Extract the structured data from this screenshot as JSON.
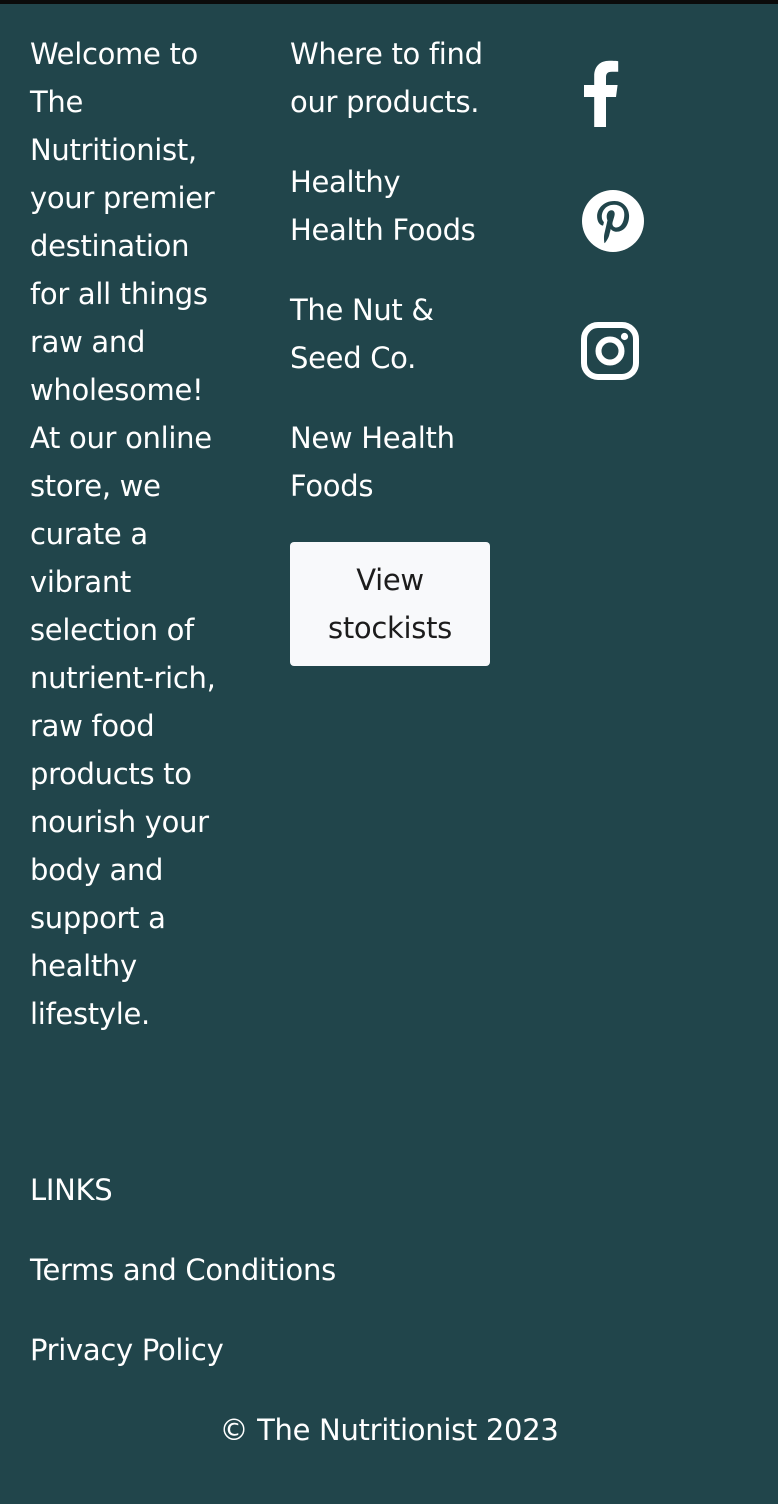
{
  "about": {
    "text": "Welcome to The Nutritionist, your premier destination for all things raw and wholesome! At our online store, we curate a vibrant selection of nutrient-rich, raw food products to nourish your body and support a healthy lifestyle."
  },
  "stockists": {
    "heading": "Where to find our products.",
    "items": [
      {
        "label": "Healthy Health Foods"
      },
      {
        "label": "The Nut & Seed Co."
      },
      {
        "label": "New Health Foods"
      }
    ],
    "button_label": "View stockists"
  },
  "social": {
    "icons": [
      "facebook-icon",
      "pinterest-icon",
      "instagram-icon"
    ]
  },
  "links": {
    "heading": "LINKS",
    "items": [
      {
        "label": "Terms and Conditions"
      },
      {
        "label": "Privacy Policy"
      }
    ]
  },
  "footer": {
    "copyright": "© The Nutritionist 2023"
  },
  "colors": {
    "background": "#21454b",
    "button_background": "#f8f9fb",
    "button_text": "#1c1c1c",
    "text": "#ffffff"
  }
}
